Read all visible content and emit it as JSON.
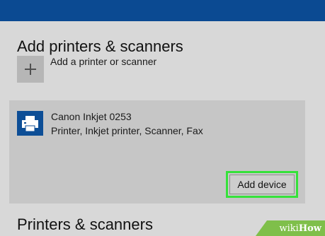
{
  "header": {
    "title_bar_color": "#0b4a92"
  },
  "add_section": {
    "title": "Add printers & scanners",
    "add_label": "Add a printer or scanner",
    "add_icon": "plus-icon"
  },
  "device": {
    "name": "Canon Inkjet 0253",
    "description": "Printer, Inkjet printer, Scanner, Fax",
    "icon": "printer-icon",
    "action_label": "Add device",
    "highlight_color": "#35e23a"
  },
  "list_section": {
    "title": "Printers & scanners"
  },
  "watermark": {
    "wiki": "wiki",
    "how": "How"
  }
}
